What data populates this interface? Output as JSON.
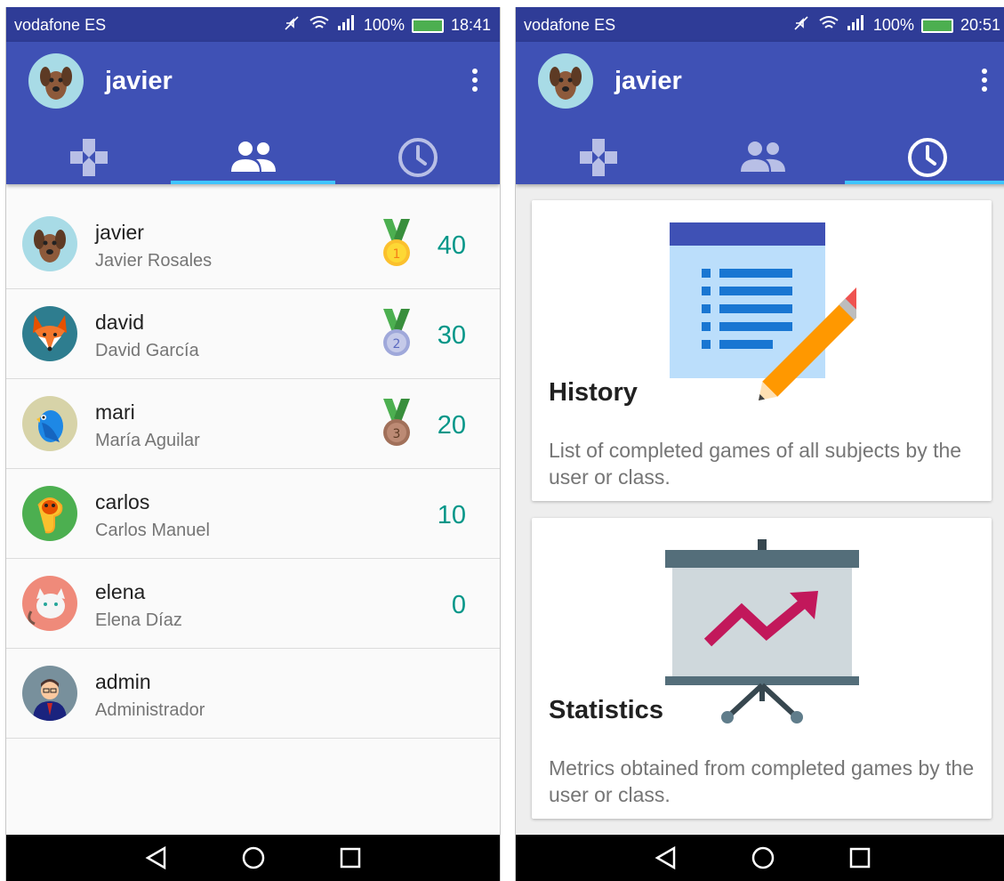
{
  "left_screen": {
    "status": {
      "carrier": "vodafone ES",
      "battery": "100%",
      "time": "18:41"
    },
    "header": {
      "username": "javier"
    },
    "active_tab": "friends",
    "users": [
      {
        "username": "javier",
        "full_name": "Javier Rosales",
        "score": "40",
        "medal": "1",
        "avatar": "dog"
      },
      {
        "username": "david",
        "full_name": "David García",
        "score": "30",
        "medal": "2",
        "avatar": "fox"
      },
      {
        "username": "mari",
        "full_name": "María Aguilar",
        "score": "20",
        "medal": "3",
        "avatar": "bird"
      },
      {
        "username": "carlos",
        "full_name": "Carlos Manuel",
        "score": "10",
        "medal": "",
        "avatar": "snake"
      },
      {
        "username": "elena",
        "full_name": "Elena Díaz",
        "score": "0",
        "medal": "",
        "avatar": "cat"
      },
      {
        "username": "admin",
        "full_name": "Administrador",
        "score": "",
        "medal": "",
        "avatar": "admin"
      }
    ]
  },
  "right_screen": {
    "status": {
      "carrier": "vodafone ES",
      "battery": "100%",
      "time": "20:51"
    },
    "header": {
      "username": "javier"
    },
    "active_tab": "history",
    "cards": [
      {
        "title": "History",
        "description": "List of completed games of all subjects by the user or class."
      },
      {
        "title": "Statistics",
        "description": "Metrics obtained from completed games by the user or class."
      }
    ]
  },
  "tabs": [
    {
      "icon": "gamepad-icon"
    },
    {
      "icon": "people-icon"
    },
    {
      "icon": "clock-icon"
    }
  ],
  "colors": {
    "primary": "#3f51b5",
    "status_bar": "#2f3c97",
    "accent": "#40c4ff",
    "score": "#009688"
  }
}
